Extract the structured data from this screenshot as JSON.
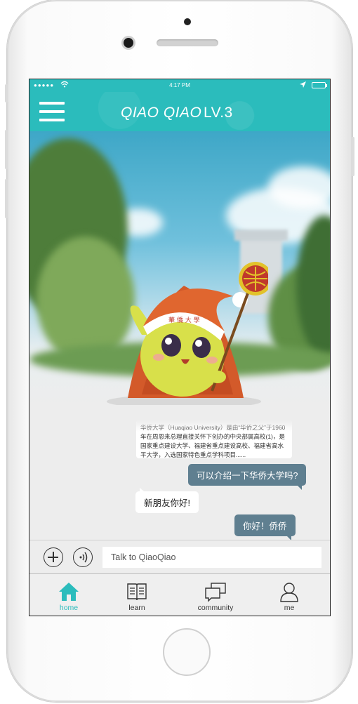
{
  "status_bar": {
    "signal": "●●●●●",
    "time": "4:17 PM"
  },
  "header": {
    "title": "QIAO QIAO",
    "level": "LV.3",
    "menu_icon": "hamburger-menu-icon"
  },
  "chat": {
    "info_card_text": "华侨大学（Huaqiao University）是由“华侨之父”于1960年在周恩来总理直接关怀下创办的中央部属高校(1)，是国家重点建设大学、福建省重点建设高校、福建省高水平大学，入选国家特色重点学科项目......",
    "messages": [
      {
        "from": "me",
        "text": "可以介绍一下华侨大学吗?"
      },
      {
        "from": "bot",
        "text": "新朋友你好!"
      },
      {
        "from": "me",
        "text": "你好！侨侨"
      }
    ]
  },
  "input_bar": {
    "add_icon": "plus-icon",
    "voice_icon": "voice-icon",
    "placeholder": "Talk to QiaoQiao"
  },
  "tabs": [
    {
      "label": "home",
      "icon": "home-icon",
      "active": true
    },
    {
      "label": "learn",
      "icon": "book-icon",
      "active": false
    },
    {
      "label": "community",
      "icon": "chat-bubbles-icon",
      "active": false
    },
    {
      "label": "me",
      "icon": "person-icon",
      "active": false
    }
  ],
  "colors": {
    "accent": "#2bbcbc",
    "user_bubble": "#5f7f90",
    "bot_bubble": "#ffffff"
  }
}
